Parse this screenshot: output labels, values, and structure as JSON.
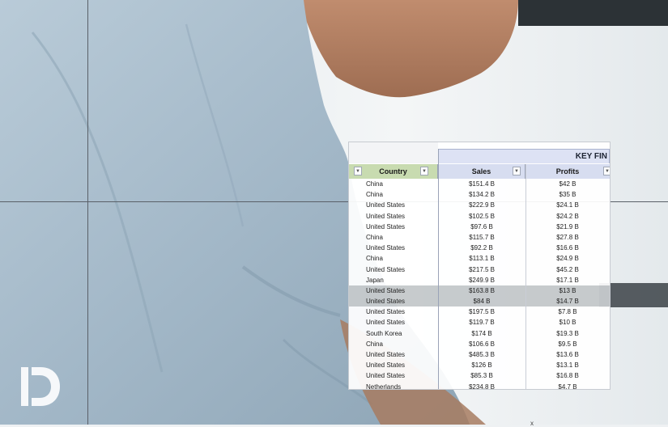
{
  "sheet": {
    "banner_title": "KEY FIN",
    "headers": {
      "country": "Country",
      "sales": "Sales",
      "profits": "Profits"
    },
    "filter_glyph": "▼",
    "selected_rows": [
      10,
      11
    ],
    "rows": [
      {
        "country": "China",
        "sales": "$151.4 B",
        "profits": "$42 B"
      },
      {
        "country": "China",
        "sales": "$134.2 B",
        "profits": "$35 B"
      },
      {
        "country": "United States",
        "sales": "$222.9 B",
        "profits": "$24.1 B"
      },
      {
        "country": "United States",
        "sales": "$102.5 B",
        "profits": "$24.2 B"
      },
      {
        "country": "United States",
        "sales": "$97.6 B",
        "profits": "$21.9 B"
      },
      {
        "country": "China",
        "sales": "$115.7 B",
        "profits": "$27.8 B"
      },
      {
        "country": "United States",
        "sales": "$92.2 B",
        "profits": "$16.6 B"
      },
      {
        "country": "China",
        "sales": "$113.1 B",
        "profits": "$24.9 B"
      },
      {
        "country": "United States",
        "sales": "$217.5 B",
        "profits": "$45.2 B"
      },
      {
        "country": "Japan",
        "sales": "$249.9 B",
        "profits": "$17.1 B"
      },
      {
        "country": "United States",
        "sales": "$163.8 B",
        "profits": "$13 B"
      },
      {
        "country": "United States",
        "sales": "$84 B",
        "profits": "$14.7 B"
      },
      {
        "country": "United States",
        "sales": "$197.5 B",
        "profits": "$7.8 B"
      },
      {
        "country": "United States",
        "sales": "$119.7 B",
        "profits": "$10 B"
      },
      {
        "country": "South Korea",
        "sales": "$174 B",
        "profits": "$19.3 B"
      },
      {
        "country": "China",
        "sales": "$106.6 B",
        "profits": "$9.5 B"
      },
      {
        "country": "United States",
        "sales": "$485.3 B",
        "profits": "$13.6 B"
      },
      {
        "country": "United States",
        "sales": "$126 B",
        "profits": "$13.1 B"
      },
      {
        "country": "United States",
        "sales": "$85.3 B",
        "profits": "$16.8 B"
      },
      {
        "country": "Netherlands",
        "sales": "$234.8 B",
        "profits": "$4.7 B"
      }
    ]
  },
  "colors": {
    "country_header": "#c8dbb0",
    "value_header": "#d7ddf0",
    "selection": "#8c9498"
  },
  "logo": {
    "name": "d-logo-icon"
  },
  "cursor": {
    "glyph": "x"
  }
}
